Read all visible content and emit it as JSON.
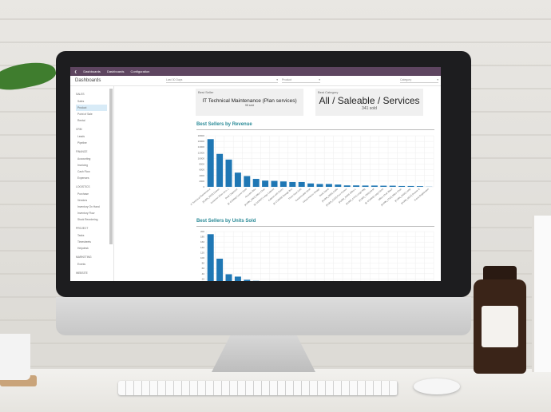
{
  "topbar": {
    "app": "Dashboards",
    "menus": [
      "Dashboards",
      "Configuration"
    ]
  },
  "control": {
    "title": "Dashboards",
    "period": "Last 30 Days",
    "product_placeholder": "Product",
    "category_placeholder": "Category"
  },
  "sidebar": [
    {
      "section": "SALES",
      "items": [
        "Sales",
        "Product",
        "Point of Sale",
        "Rental"
      ],
      "active": "Product"
    },
    {
      "section": "CRM",
      "items": [
        "Leads",
        "Pipeline"
      ]
    },
    {
      "section": "FINANCE",
      "items": [
        "Accounting",
        "Invoicing",
        "Cash Flow",
        "Expenses"
      ]
    },
    {
      "section": "LOGISTICS",
      "items": [
        "Purchase",
        "Vendors",
        "Inventory On Hand",
        "Inventory Flow",
        "Stock Reordering"
      ]
    },
    {
      "section": "PROJECT",
      "items": [
        "Tasks",
        "Timesheets",
        "Helpdesk"
      ]
    },
    {
      "section": "MARKETING",
      "items": [
        "Events"
      ]
    },
    {
      "section": "WEBSITE",
      "items": []
    }
  ],
  "best_seller": {
    "label": "Best Seller",
    "value": "IT Technical Maintenance (Plan services)",
    "sub": "98 sold"
  },
  "best_category": {
    "label": "Best Category",
    "value": "All / Saleable / Services",
    "sub": "341 sold"
  },
  "chart_data": [
    {
      "type": "bar",
      "title": "Best Sellers by Revenue",
      "ylim": [
        0,
        18000
      ],
      "yticks": [
        0,
        2000,
        4000,
        6000,
        8000,
        10000,
        12000,
        14000,
        16000,
        18000
      ],
      "grid": true,
      "color": "#1f77b4",
      "categories": [
        "IT Technical Maintenance",
        "[FURN_8900] Drawer",
        "Customer (Plan serv...)",
        "Desk Organizer",
        "[E-COM06] Corner Desk",
        "Acoustic Bloc",
        "[FURN_0269] Office Chair",
        "[E-COM07] Large Cabinet",
        "Cabinet with Doors",
        "[E-COM08] Storage Box",
        "Three-Seat Sofa",
        "Customizable Desk",
        "Virtual Interior Design",
        "Desk Stand",
        "[FURN_5555] Cable",
        "[FURN_8220] Four Person",
        "[FURN_8999] Office L",
        "[FURN_6741] Large Mtg",
        "[FURN_7800] Desk",
        "[E-COM09] Large Desk",
        "Office Chair Black",
        "[FURN_0789] Office Chair",
        "[FURN_8888] Lamp",
        "[FURN_8522] Drawer B",
        "Event Registration"
      ],
      "values": [
        16800,
        11600,
        9600,
        5000,
        3800,
        2800,
        2200,
        2100,
        1900,
        1700,
        1700,
        1200,
        1000,
        1000,
        800,
        500,
        500,
        450,
        450,
        400,
        400,
        300,
        300,
        250,
        50
      ]
    },
    {
      "type": "bar",
      "title": "Best Sellers by Units Sold",
      "ylim": [
        0,
        200
      ],
      "yticks": [
        20,
        40,
        60,
        80,
        100,
        120,
        140,
        160,
        180,
        200
      ],
      "grid": true,
      "color": "#1f77b4",
      "values": [
        190,
        97,
        38,
        29,
        17,
        13,
        12,
        12
      ]
    }
  ]
}
